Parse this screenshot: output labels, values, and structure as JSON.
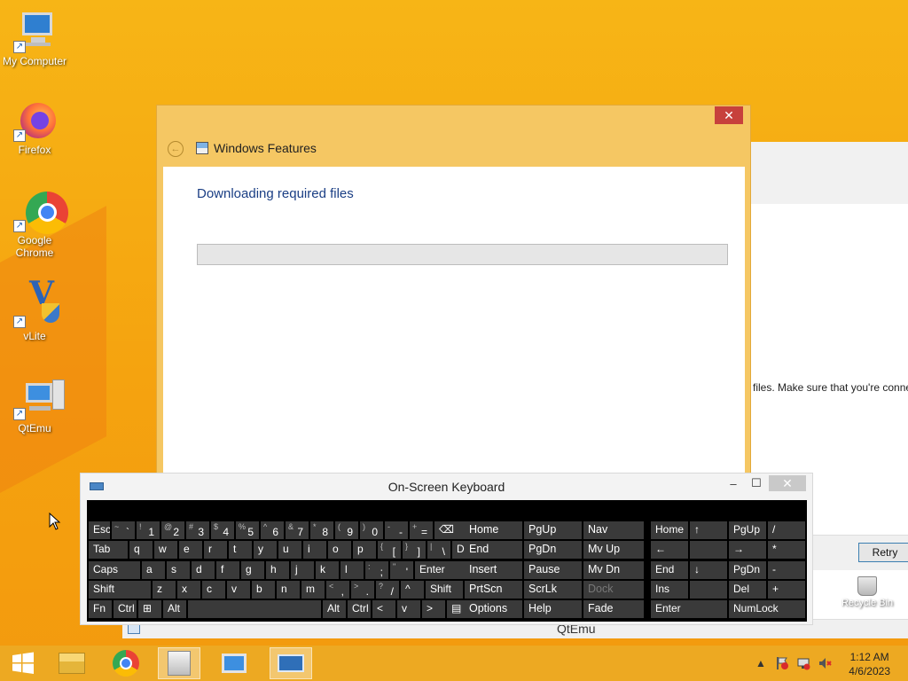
{
  "colors": {
    "wallpaper": "#f5a30f",
    "dialog_frame": "#f5c763",
    "close_red": "#c7413c",
    "keyboard_key": "#3a3a3a",
    "heading_blue": "#1a3e84"
  },
  "desktop": {
    "icons": [
      {
        "label": "My Computer",
        "icon": "computer-icon"
      },
      {
        "label": "Firefox",
        "icon": "firefox-icon"
      },
      {
        "label": "Google Chrome",
        "icon": "chrome-icon"
      },
      {
        "label": "vLite",
        "icon": "vlite-icon"
      },
      {
        "label": "QtEmu",
        "icon": "qtemu-icon"
      }
    ],
    "recycle_bin": "Recycle Bin"
  },
  "background_window": {
    "message": "files. Make sure that you're conne",
    "retry_label": "Retry"
  },
  "features_dialog": {
    "title": "Windows Features",
    "close_glyph": "✕",
    "back_glyph": "←",
    "heading": "Downloading required files",
    "progress": 0.0
  },
  "osk": {
    "title": "On-Screen Keyboard",
    "minimize": "–",
    "maximize": "☐",
    "close": "✕",
    "rows": [
      [
        {
          "p": "Esc"
        },
        {
          "s": "~",
          "p": "`"
        },
        {
          "s": "!",
          "p": "1"
        },
        {
          "s": "@",
          "p": "2"
        },
        {
          "s": "#",
          "p": "3"
        },
        {
          "s": "$",
          "p": "4"
        },
        {
          "s": "%",
          "p": "5"
        },
        {
          "s": "^",
          "p": "6"
        },
        {
          "s": "&",
          "p": "7"
        },
        {
          "s": "*",
          "p": "8"
        },
        {
          "s": "(",
          "p": "9"
        },
        {
          "s": ")",
          "p": "0"
        },
        {
          "s": "-",
          "p": "-"
        },
        {
          "s": "+",
          "p": "="
        },
        {
          "p": "⌫"
        }
      ],
      [
        {
          "p": "Tab"
        },
        {
          "p": "q"
        },
        {
          "p": "w"
        },
        {
          "p": "e"
        },
        {
          "p": "r"
        },
        {
          "p": "t"
        },
        {
          "p": "y"
        },
        {
          "p": "u"
        },
        {
          "p": "i"
        },
        {
          "p": "o"
        },
        {
          "p": "p"
        },
        {
          "s": "{",
          "p": "["
        },
        {
          "s": "}",
          "p": "]"
        },
        {
          "s": "|",
          "p": "\\"
        },
        {
          "p": "Del"
        }
      ],
      [
        {
          "p": "Caps"
        },
        {
          "p": "a"
        },
        {
          "p": "s"
        },
        {
          "p": "d"
        },
        {
          "p": "f"
        },
        {
          "p": "g"
        },
        {
          "p": "h"
        },
        {
          "p": "j"
        },
        {
          "p": "k"
        },
        {
          "p": "l"
        },
        {
          "s": ":",
          "p": ";"
        },
        {
          "s": "\"",
          "p": "'"
        },
        {
          "p": "Enter"
        }
      ],
      [
        {
          "p": "Shift"
        },
        {
          "p": "z"
        },
        {
          "p": "x"
        },
        {
          "p": "c"
        },
        {
          "p": "v"
        },
        {
          "p": "b"
        },
        {
          "p": "n"
        },
        {
          "p": "m"
        },
        {
          "s": "<",
          "p": ","
        },
        {
          "s": ">",
          "p": "."
        },
        {
          "s": "?",
          "p": "/"
        },
        {
          "p": "^"
        },
        {
          "p": "Shift"
        }
      ],
      [
        {
          "p": "Fn"
        },
        {
          "p": "Ctrl"
        },
        {
          "p": "⊞"
        },
        {
          "p": "Alt"
        },
        {
          "p": ""
        },
        {
          "p": "Alt"
        },
        {
          "p": "Ctrl"
        },
        {
          "p": "<"
        },
        {
          "p": "v"
        },
        {
          "p": ">"
        },
        {
          "p": "▤"
        }
      ]
    ],
    "nav_block": [
      [
        "Home",
        "PgUp",
        "Nav"
      ],
      [
        "End",
        "PgDn",
        "Mv Up"
      ],
      [
        "Insert",
        "Pause",
        "Mv Dn"
      ],
      [
        "PrtScn",
        "ScrLk",
        "Dock"
      ],
      [
        "Options",
        "Help",
        "Fade"
      ]
    ],
    "numpad": [
      [
        "Home",
        "↑",
        "PgUp",
        "/"
      ],
      [
        "←",
        "",
        "→",
        "*"
      ],
      [
        "End",
        "↓",
        "PgDn",
        "-"
      ],
      [
        "Ins",
        "",
        "Del",
        "+"
      ],
      [
        "Enter",
        "",
        "NumLock",
        ""
      ]
    ]
  },
  "qtemu_strip": {
    "title": "QtEmu"
  },
  "taskbar": {
    "apps": [
      "start-icon",
      "file-explorer-icon",
      "chrome-icon",
      "vlite-task-icon",
      "qtemu-task-icon",
      "osk-task-icon"
    ],
    "tray_up": "▲",
    "time": "1:12 AM",
    "date": "4/6/2023"
  }
}
